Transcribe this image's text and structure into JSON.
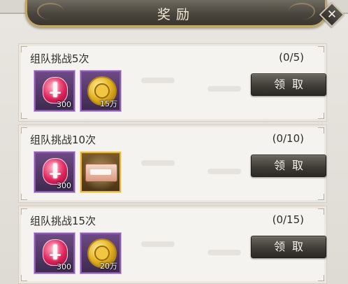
{
  "dialog": {
    "title": "奖励",
    "close_glyph": "✕"
  },
  "tasks": [
    {
      "title": "组队挑战5次",
      "progress": "(0/5)",
      "claim_label": "领取",
      "rewards": [
        {
          "icon": "red-gem-icon",
          "count": "300"
        },
        {
          "icon": "gold-coin-icon",
          "count": "15万"
        }
      ]
    },
    {
      "title": "组队挑战10次",
      "progress": "(0/10)",
      "claim_label": "领取",
      "rewards": [
        {
          "icon": "red-gem-icon",
          "count": "300"
        },
        {
          "icon": "ticket-icon",
          "count": ""
        }
      ]
    },
    {
      "title": "组队挑战15次",
      "progress": "(0/15)",
      "claim_label": "领取",
      "rewards": [
        {
          "icon": "red-gem-icon",
          "count": "300"
        },
        {
          "icon": "gold-coin-icon",
          "count": "20万"
        }
      ]
    }
  ]
}
